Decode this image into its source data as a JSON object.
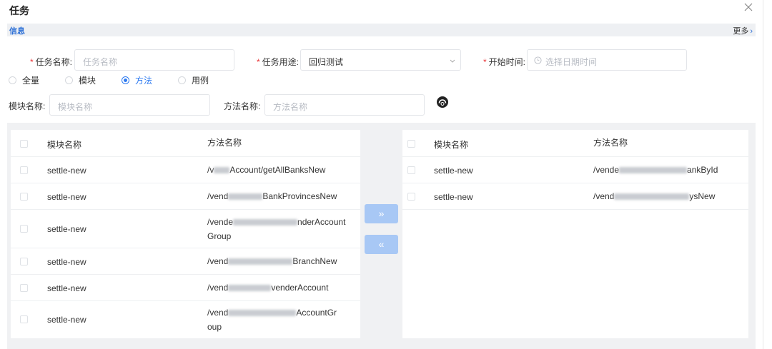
{
  "dialog": {
    "title": "任务"
  },
  "info": {
    "label": "信息",
    "more": "更多",
    "more_arrow": "›"
  },
  "form": {
    "task_name": {
      "label": "任务名称:",
      "placeholder": "任务名称"
    },
    "task_purpose": {
      "label": "任务用途:",
      "value": "回归测试"
    },
    "start_time": {
      "label": "开始时间:",
      "placeholder": "选择日期时间"
    },
    "required_mark": "*"
  },
  "scope_radios": [
    {
      "label": "全量",
      "checked": false
    },
    {
      "label": "模块",
      "checked": false
    },
    {
      "label": "方法",
      "checked": true
    },
    {
      "label": "用例",
      "checked": false
    }
  ],
  "filters": {
    "module_name": {
      "label": "模块名称:",
      "placeholder": "模块名称"
    },
    "method_name": {
      "label": "方法名称:",
      "placeholder": "方法名称"
    }
  },
  "left_table": {
    "headers": [
      "模块名称",
      "方法名称"
    ],
    "rows": [
      {
        "module": "settle-new",
        "method_a": "/v",
        "method_b": "Account/getAllBanksNew"
      },
      {
        "module": "settle-new",
        "method_a": "/vend",
        "method_b": "BankProvincesNew"
      },
      {
        "module": "settle-new",
        "method_a": "/vende",
        "method_b": "nderAccount",
        "method_c": "Group"
      },
      {
        "module": "settle-new",
        "method_a": "/vend",
        "method_b": "BranchNew"
      },
      {
        "module": "settle-new",
        "method_a": "/vend",
        "method_b": "venderAccount"
      },
      {
        "module": "settle-new",
        "method_a": "/vend",
        "method_b": "AccountGr",
        "method_c": "oup"
      }
    ]
  },
  "transfer": {
    "right_label": "»",
    "left_label": "«"
  },
  "right_table": {
    "headers": [
      "模块名称",
      "方法名称"
    ],
    "rows": [
      {
        "module": "settle-new",
        "method_a": "/vende",
        "method_b": "ankById"
      },
      {
        "module": "settle-new",
        "method_a": "/vend",
        "method_b": "ysNew"
      }
    ]
  }
}
